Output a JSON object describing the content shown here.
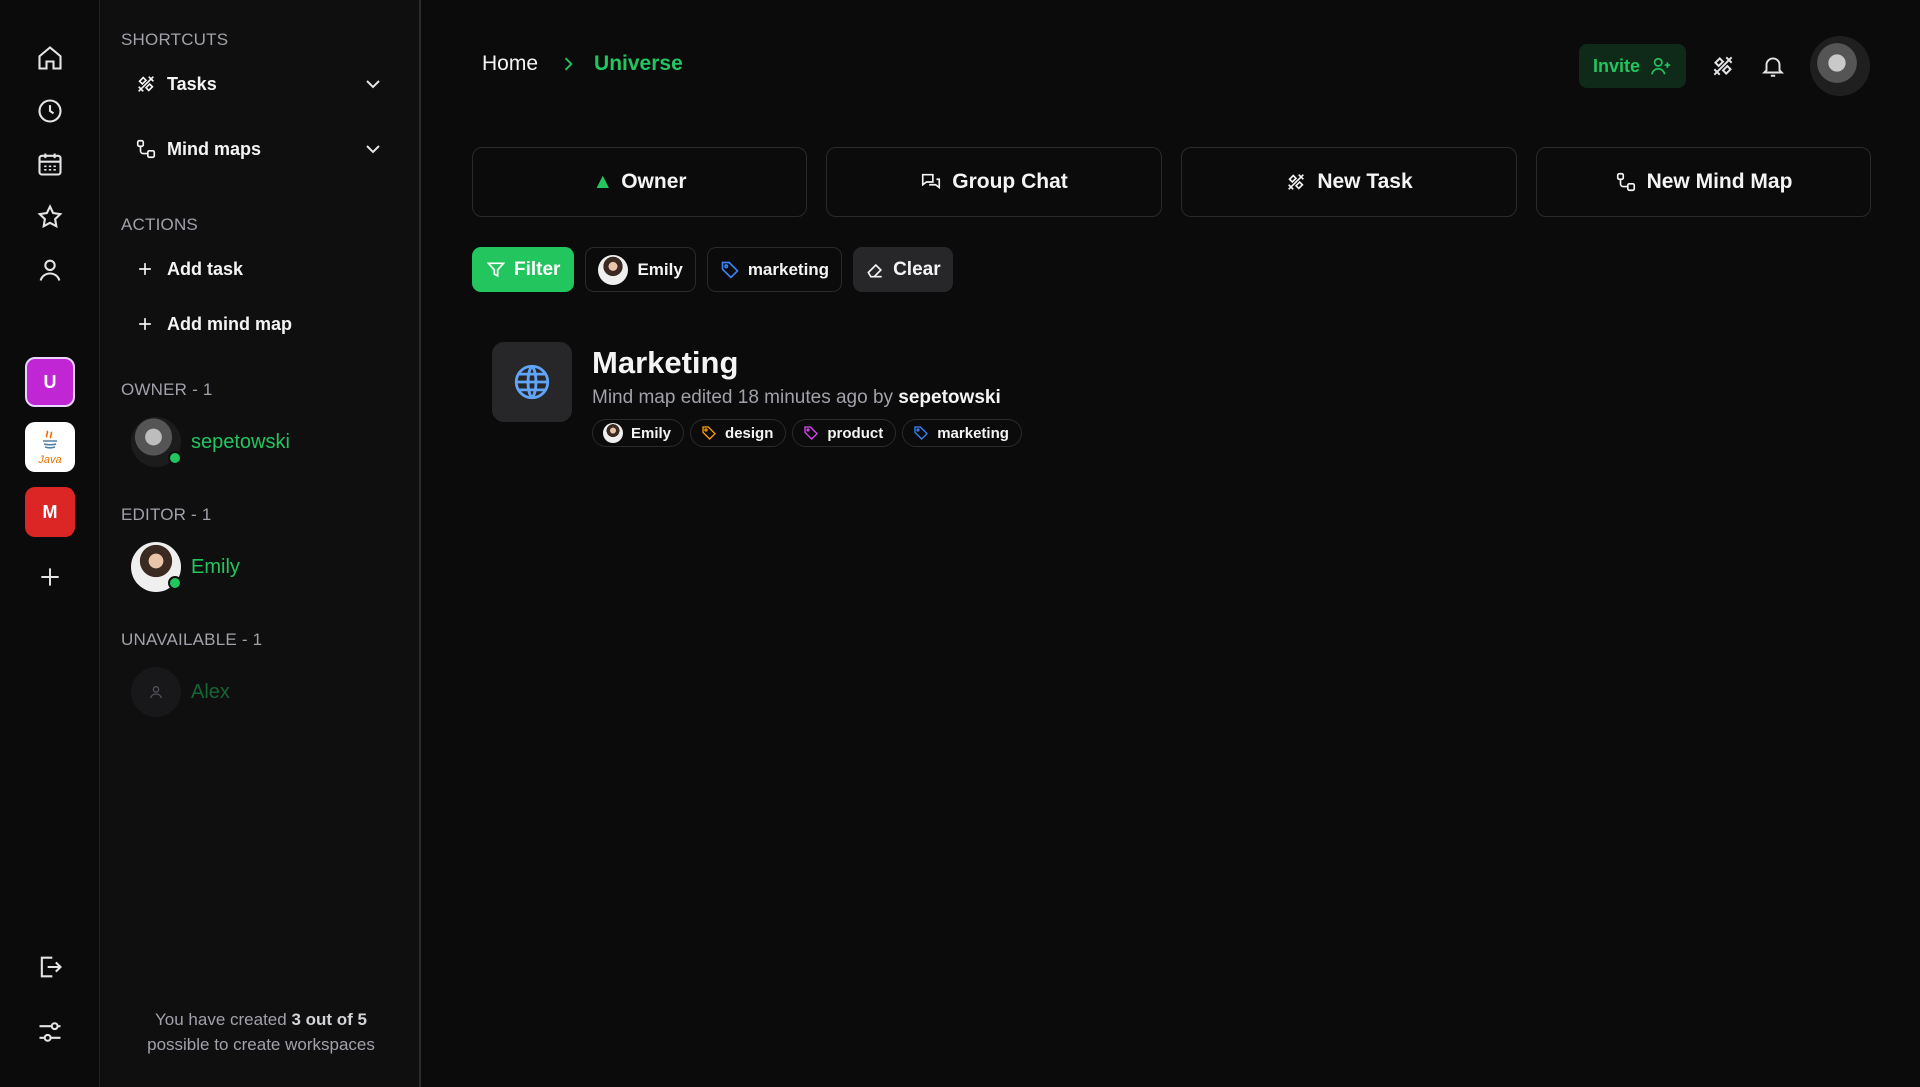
{
  "rail": {
    "icons": [
      "home-icon",
      "clock-icon",
      "calendar-icon",
      "star-icon",
      "user-icon"
    ],
    "workspaces": [
      {
        "label": "U",
        "color": "#c026d3"
      },
      {
        "label": "Java",
        "color": "#ffffff"
      },
      {
        "label": "M",
        "color": "#dc2626"
      }
    ],
    "bottom_icons": [
      "logout-icon",
      "settings-sliders-icon"
    ]
  },
  "sidebar": {
    "shortcuts_title": "SHORTCUTS",
    "shortcuts": [
      {
        "label": "Tasks",
        "icon": "tasks-icon"
      },
      {
        "label": "Mind maps",
        "icon": "mindmap-icon"
      }
    ],
    "actions_title": "ACTIONS",
    "actions": [
      {
        "label": "Add task"
      },
      {
        "label": "Add mind map"
      }
    ],
    "groups": [
      {
        "title": "OWNER - 1",
        "member": "sepetowski",
        "online": true
      },
      {
        "title": "EDITOR - 1",
        "member": "Emily",
        "online": true
      },
      {
        "title": "UNAVAILABLE - 1",
        "member": "Alex",
        "online": false
      }
    ],
    "quota": {
      "prefix": "You have created",
      "count": "3 out of 5",
      "suffix": "possible to create workspaces"
    }
  },
  "header": {
    "breadcrumb_home": "Home",
    "breadcrumb_current": "Universe",
    "invite_label": "Invite"
  },
  "quick_actions": [
    {
      "label": "Owner",
      "icon": "emoji-owner-icon"
    },
    {
      "label": "Group Chat",
      "icon": "chat-icon"
    },
    {
      "label": "New Task",
      "icon": "tasks-icon"
    },
    {
      "label": "New Mind Map",
      "icon": "mindmap-icon"
    }
  ],
  "filters": {
    "filter_label": "Filter",
    "user_chip": "Emily",
    "tag_chip": "marketing",
    "clear_label": "Clear"
  },
  "item": {
    "title": "Marketing",
    "subtitle": "Mind map edited 18 minutes ago by",
    "author": "sepetowski",
    "tags": [
      {
        "label": "Emily",
        "type": "user"
      },
      {
        "label": "design",
        "color": "#f59e0b"
      },
      {
        "label": "product",
        "color": "#d946ef"
      },
      {
        "label": "marketing",
        "color": "#3b82f6"
      }
    ]
  },
  "colors": {
    "accent": "#22c55e",
    "background": "#0b0b0b"
  }
}
